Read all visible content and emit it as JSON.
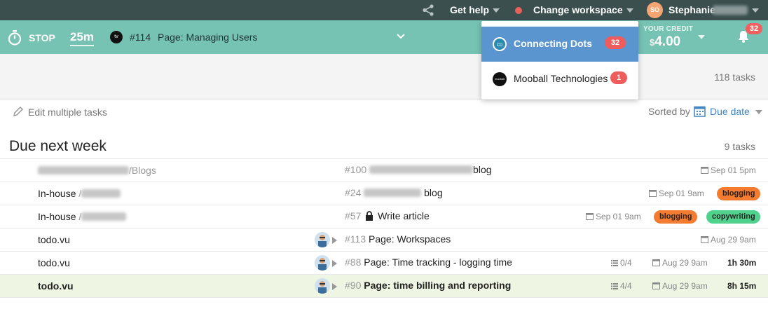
{
  "topbar": {
    "get_help": "Get help",
    "change_workspace": "Change workspace",
    "user_initials": "SO",
    "user_name": "Stephanie"
  },
  "timer": {
    "stop_label": "STOP",
    "elapsed": "25m",
    "project_logo_text": "tv",
    "task_number": "#114",
    "task_title": "Page: Managing Users"
  },
  "credit": {
    "label": "YOUR CREDIT",
    "currency": "$",
    "amount": "4.00"
  },
  "notifications": {
    "count": "32"
  },
  "workspace_dropdown": {
    "items": [
      {
        "logo": "CD",
        "label": "Connecting Dots",
        "badge": "32",
        "active": true
      },
      {
        "logo": "mooball",
        "label": "Mooball Technologies",
        "badge": "1",
        "active": false
      }
    ]
  },
  "summary": {
    "total_tasks": "118 tasks"
  },
  "toolbar": {
    "edit_multiple": "Edit multiple tasks",
    "sorted_by_label": "Sorted by",
    "sorted_by_value": "Due date"
  },
  "section": {
    "title": "Due next week",
    "count": "9 tasks"
  },
  "tasks": [
    {
      "project": "",
      "project_sub": "/Blogs",
      "number": "#100",
      "title": "blog",
      "date": "Sep 01 5pm"
    },
    {
      "project": "In-house",
      "project_sub": "/",
      "number": "#24",
      "title": "blog",
      "date": "Sep 01 9am",
      "tags": [
        "blogging"
      ]
    },
    {
      "project": "In-house",
      "project_sub": "/",
      "number": "#57",
      "title": "Write article",
      "date": "Sep 01 9am",
      "tags": [
        "blogging",
        "copywriting"
      ]
    },
    {
      "project": "todo.vu",
      "number": "#113",
      "title": "Page: Workspaces",
      "date": "Aug 29 9am"
    },
    {
      "project": "todo.vu",
      "number": "#88",
      "title": "Page: Time tracking - logging time",
      "checklist": "0/4",
      "date": "Aug 29 9am",
      "duration": "1h 30m"
    },
    {
      "project": "todo.vu",
      "number": "#90",
      "title": "Page: time billing and reporting",
      "checklist": "4/4",
      "date": "Aug 29 9am",
      "duration": "8h 15m"
    }
  ],
  "colors": {
    "topbar": "#3b4f4f",
    "timerbar": "#76c2b3",
    "accent_blue": "#3f86c5",
    "tag_blogging": "#f47b30",
    "tag_copywriting": "#4fd28c",
    "badge_red": "#ee5c5c"
  }
}
